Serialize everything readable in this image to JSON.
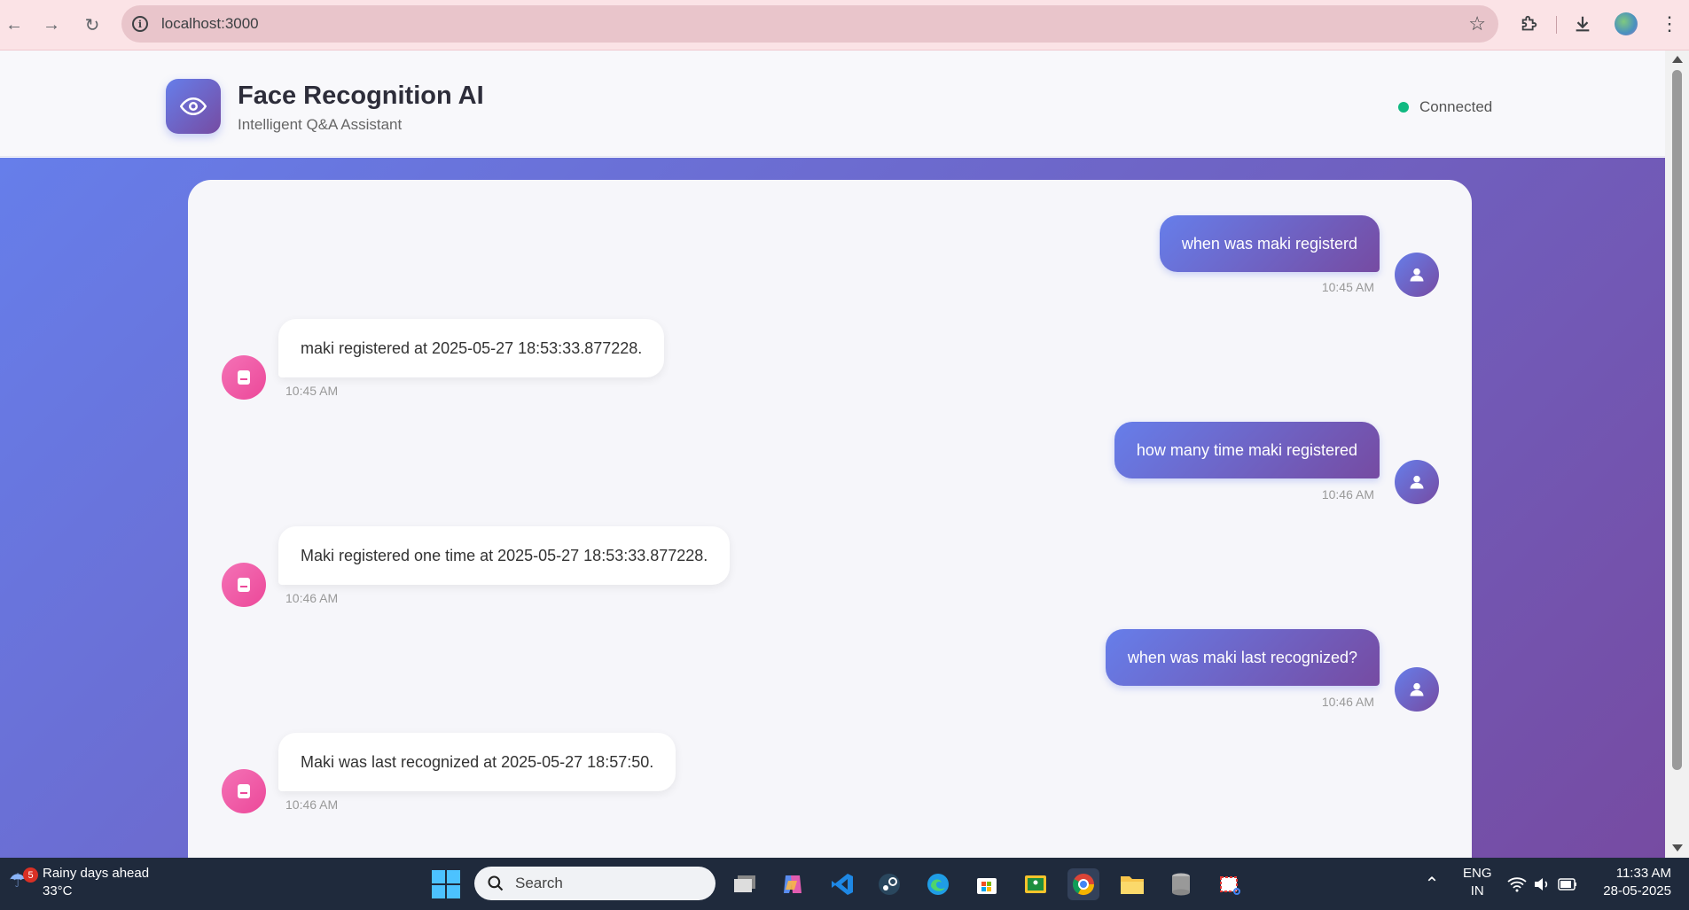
{
  "browser": {
    "url": "localhost:3000"
  },
  "header": {
    "title": "Face Recognition AI",
    "subtitle": "Intelligent Q&A Assistant",
    "status": "Connected"
  },
  "colors": {
    "accent_start": "#667eea",
    "accent_end": "#764ba2",
    "bot_accent": "#ec4899",
    "status_ok": "#10b981"
  },
  "messages": [
    {
      "role": "user",
      "text": "when was maki registerd",
      "time": "10:45 AM"
    },
    {
      "role": "bot",
      "text": "maki registered at 2025-05-27 18:53:33.877228.",
      "time": "10:45 AM"
    },
    {
      "role": "user",
      "text": "how many time maki registered",
      "time": "10:46 AM"
    },
    {
      "role": "bot",
      "text": "Maki registered one time at 2025-05-27 18:53:33.877228.",
      "time": "10:46 AM"
    },
    {
      "role": "user",
      "text": "when was maki last recognized?",
      "time": "10:46 AM"
    },
    {
      "role": "bot",
      "text": "Maki was last recognized at 2025-05-27 18:57:50.",
      "time": "10:46 AM"
    }
  ],
  "taskbar": {
    "weather_title": "Rainy days ahead",
    "weather_temp": "33°C",
    "weather_badge": "5",
    "search_label": "Search",
    "lang_top": "ENG",
    "lang_bottom": "IN",
    "time": "11:33 AM",
    "date": "28-05-2025"
  }
}
